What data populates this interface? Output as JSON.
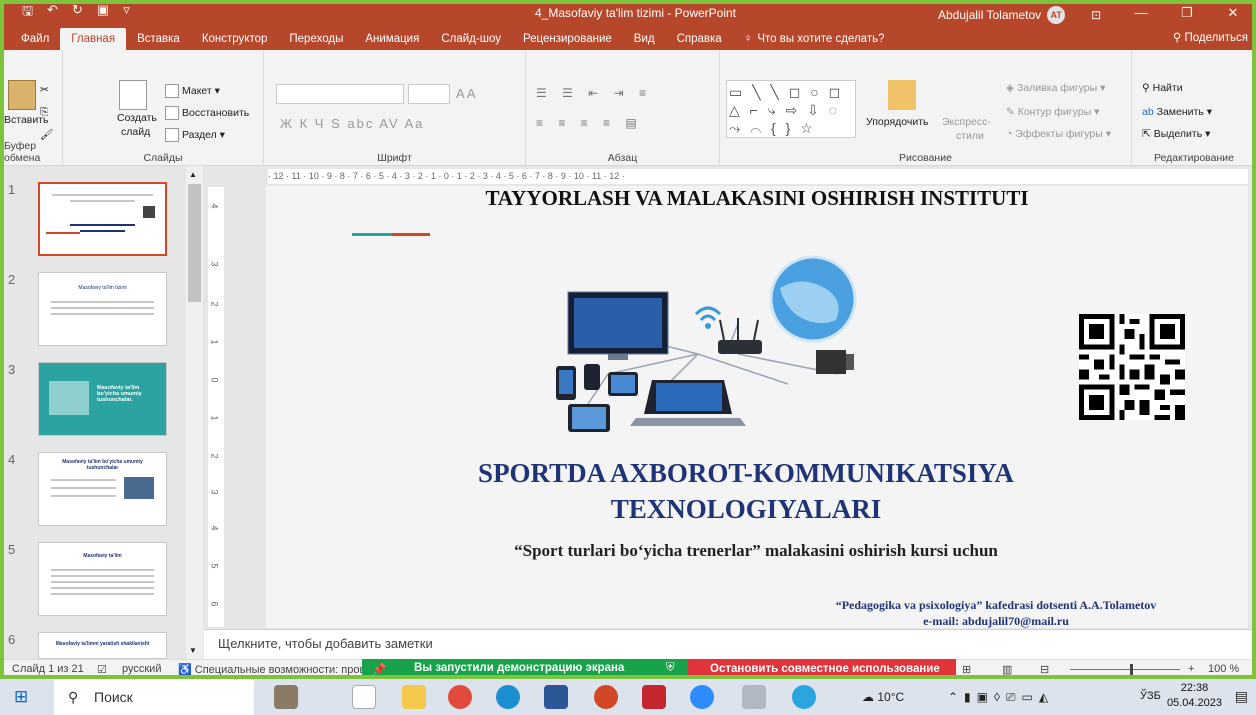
{
  "window": {
    "title": "4_Masofaviy ta'lim tizimi  -  PowerPoint",
    "user": "Abdujalil Tolametov",
    "initials": "AT",
    "share": "Поделиться"
  },
  "ribbon_tabs": [
    "Файл",
    "Главная",
    "Вставка",
    "Конструктор",
    "Переходы",
    "Анимация",
    "Слайд-шоу",
    "Рецензирование",
    "Вид",
    "Справка"
  ],
  "active_tab": "Главная",
  "tell_me": "Что вы хотите сделать?",
  "ribbon": {
    "clipboard": {
      "paste": "Вставить",
      "label": "Буфер обмена"
    },
    "slides": {
      "new_slide": "Создать",
      "new_slide2": "слайд",
      "layout": "Макет",
      "reset": "Восстановить",
      "section": "Раздел",
      "label": "Слайды"
    },
    "font": {
      "label": "Шрифт",
      "buttons": "Ж К Ч S abc AV Aa",
      "size_buttons": "A A"
    },
    "paragraph": {
      "label": "Абзац"
    },
    "drawing": {
      "arrange": "Упорядочить",
      "styles1": "Экспресс-",
      "styles2": "стили",
      "fill": "Заливка фигуры",
      "outline": "Контур фигуры",
      "effects": "Эффекты фигуры",
      "label": "Рисование"
    },
    "editing": {
      "find": "Найти",
      "replace": "Заменить",
      "select": "Выделить",
      "label": "Редактирование"
    }
  },
  "thumbnails": [
    {
      "num": "1",
      "text": ""
    },
    {
      "num": "2",
      "text": "Masofaviy ta'lim tizimi"
    },
    {
      "num": "3",
      "text": "Masofaviy ta'lim bo'yicha umumiy tushunchalar."
    },
    {
      "num": "4",
      "text": "Masofaviy ta'lim bo'yicha umumiy tushunchalar"
    },
    {
      "num": "5",
      "text": "Masofaviy ta'lim"
    },
    {
      "num": "6",
      "text": "Masofaviy ta'limni yaratish shakllanishi"
    }
  ],
  "ruler": {
    "h": "· 12 · 11 · 10 · 9 · 8 · 7 · 6 · 5 · 4 · 3 · 2 · 1 · 0 · 1 · 2 · 3 · 4 · 5 · 6 · 7 · 8 · 9 · 10 · 11 · 12 ·",
    "v": [
      "4",
      "3",
      "2",
      "1",
      "0",
      "1",
      "2",
      "3",
      "4",
      "5",
      "6"
    ]
  },
  "slide": {
    "institute": "TAYYORLASH VA MALAKASINI OSHIRISH INSTITUTI",
    "title_line1": "SPORTDA AXBOROT-KOMMUNIKATSIYA",
    "title_line2": "TEXNOLOGIYALARI",
    "subtitle": "“Sport turlari bo‘yicha trenerlar” malakasini oshirish kursi uchun",
    "author": "“Pedagogika va psixologiya” kafedrasi dotsenti  A.A.Tolametov",
    "email": "e-mail:  abdujalil70@mail.ru"
  },
  "notes_placeholder": "Щелкните, чтобы добавить заметки",
  "status": {
    "slide": "Слайд 1 из 21",
    "language": "русский",
    "accessibility": "Специальные возможности: прове",
    "zoom": "100 %"
  },
  "share_banner": {
    "message": "Вы запустили демонстрацию экрана",
    "stop": "Остановить совместное использование"
  },
  "taskbar": {
    "search": "Поиск",
    "weather": "10°C",
    "lang": "ЎЗБ",
    "time": "22:38",
    "date": "05.04.2023"
  },
  "colors": {
    "accent": "#b7472a",
    "title_blue": "#1f3476",
    "share_green": "#18a34a",
    "stop_red": "#e0343a"
  }
}
